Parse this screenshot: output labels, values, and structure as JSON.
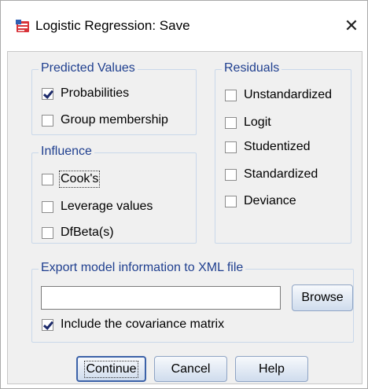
{
  "window": {
    "title": "Logistic Regression: Save",
    "close_label": "✕"
  },
  "predicted": {
    "title": "Predicted Values",
    "items": [
      {
        "label": "Probabilities",
        "checked": true
      },
      {
        "label": "Group membership",
        "checked": false
      }
    ]
  },
  "influence": {
    "title": "Influence",
    "items": [
      {
        "label": "Cook's",
        "checked": false
      },
      {
        "label": "Leverage values",
        "checked": false
      },
      {
        "label": "DfBeta(s)",
        "checked": false
      }
    ]
  },
  "residuals": {
    "title": "Residuals",
    "items": [
      {
        "label": "Unstandardized",
        "checked": false
      },
      {
        "label": "Logit",
        "checked": false
      },
      {
        "label": "Studentized",
        "checked": false
      },
      {
        "label": "Standardized",
        "checked": false
      },
      {
        "label": "Deviance",
        "checked": false
      }
    ]
  },
  "export": {
    "title": "Export model information to XML file",
    "file_value": "",
    "browse_label": "Browse",
    "include_label": "Include the covariance matrix",
    "include_checked": true
  },
  "buttons": {
    "continue": "Continue",
    "cancel": "Cancel",
    "help": "Help"
  }
}
